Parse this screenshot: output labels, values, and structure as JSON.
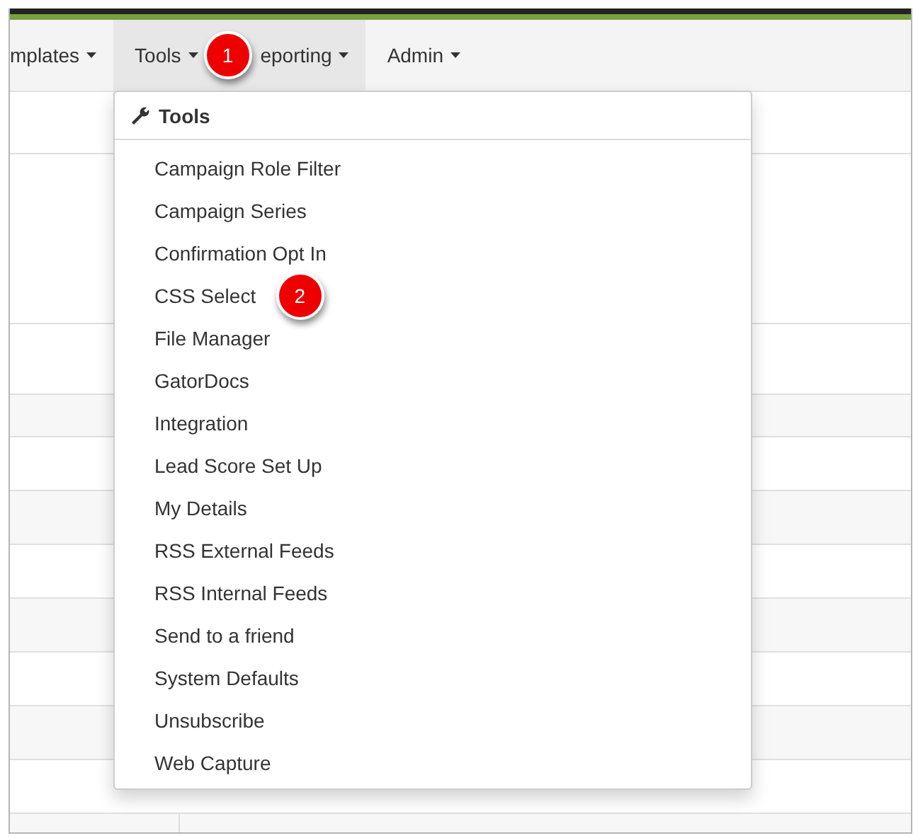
{
  "nav": {
    "items": [
      {
        "label": "mplates",
        "selected": false
      },
      {
        "label": "Tools",
        "selected": true
      },
      {
        "label": "eporting",
        "selected": true
      },
      {
        "label": "Admin",
        "selected": false
      }
    ]
  },
  "dropdown": {
    "header": "Tools",
    "items": [
      {
        "label": "Campaign Role Filter"
      },
      {
        "label": "Campaign Series"
      },
      {
        "label": "Confirmation Opt In"
      },
      {
        "label": "CSS Select"
      },
      {
        "label": "File Manager"
      },
      {
        "label": "GatorDocs"
      },
      {
        "label": "Integration"
      },
      {
        "label": "Lead Score Set Up"
      },
      {
        "label": "My Details"
      },
      {
        "label": "RSS External Feeds"
      },
      {
        "label": "RSS Internal Feeds"
      },
      {
        "label": "Send to a friend"
      },
      {
        "label": "System Defaults"
      },
      {
        "label": "Unsubscribe"
      },
      {
        "label": "Web Capture"
      }
    ]
  },
  "callouts": [
    {
      "label": "1"
    },
    {
      "label": "2"
    }
  ]
}
